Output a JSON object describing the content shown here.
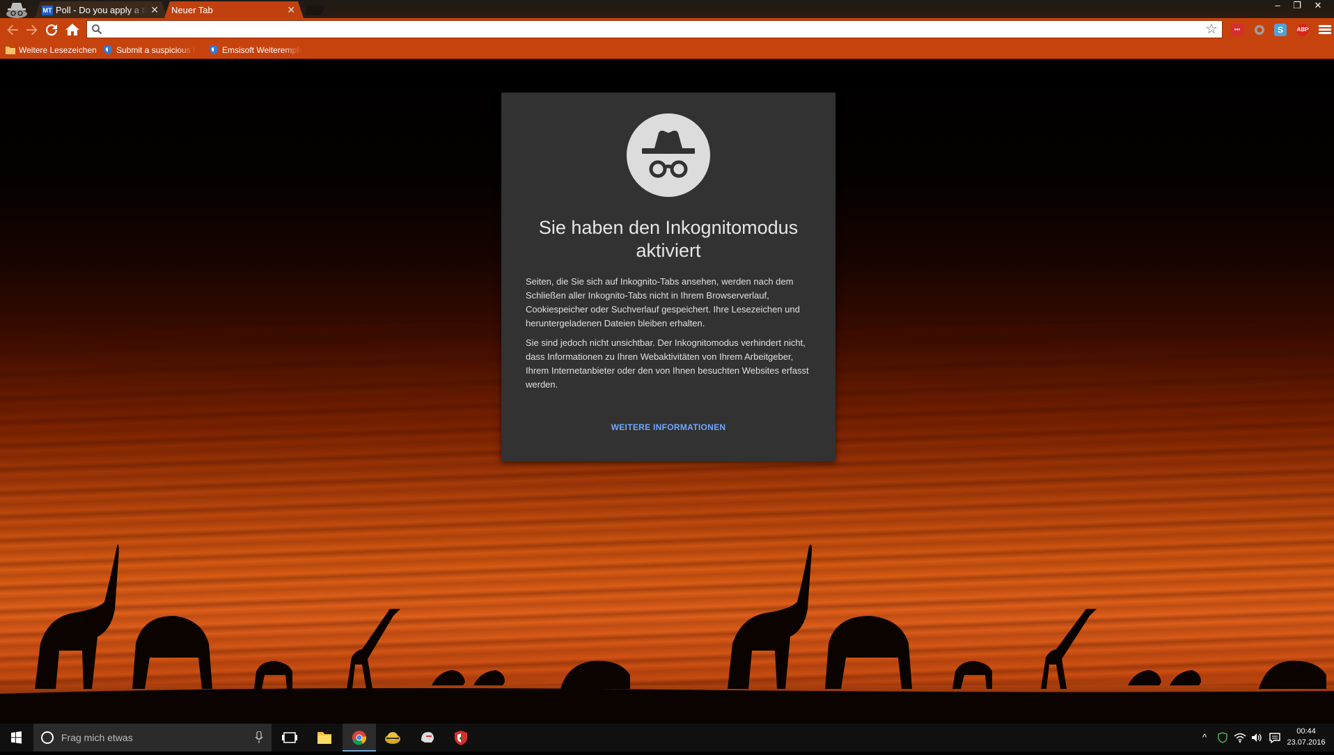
{
  "browser": {
    "tabs": [
      {
        "label": "Poll - Do you apply a them",
        "favicon_text": "MT",
        "active": false
      },
      {
        "label": "Neuer Tab",
        "active": true
      }
    ],
    "window_controls": {
      "minimize": "–",
      "restore": "❐",
      "close": "✕"
    },
    "omnibox": {
      "value": "",
      "placeholder": ""
    },
    "extensions": [
      {
        "name": "lastpass-icon",
        "text": "•••",
        "color": "#d32f2f"
      },
      {
        "name": "opera-icon",
        "text": "",
        "color": "#9e9e9e"
      },
      {
        "name": "skype-icon",
        "text": "S",
        "color": "#4fa3d9"
      },
      {
        "name": "adblock-plus-icon",
        "text": "ABP",
        "color": "#d6251d"
      }
    ],
    "bookmarks": [
      {
        "label": "Weitere Lesezeichen",
        "icon": "folder-icon"
      },
      {
        "label": "Submit a suspicious fi",
        "icon": "emsisoft-shield-icon"
      },
      {
        "label": "Emsisoft Weiterempfe",
        "icon": "emsisoft-shield-icon"
      }
    ]
  },
  "incognito": {
    "title": "Sie haben den Inkognitomodus aktiviert",
    "paragraph1": "Seiten, die Sie sich auf Inkognito-Tabs ansehen, werden nach dem Schließen aller Inkognito-Tabs nicht in Ihrem Browserverlauf, Cookiespeicher oder Suchverlauf gespeichert. Ihre Lesezeichen und heruntergeladenen Dateien bleiben erhalten.",
    "paragraph2": "Sie sind jedoch nicht unsichtbar. Der Inkognitomodus verhindert nicht, dass Informationen zu Ihren Webaktivitäten von Ihrem Arbeitgeber, Ihrem Internetanbieter oder den von Ihnen besuchten Websites erfasst werden.",
    "link": "WEITERE INFORMATIONEN"
  },
  "taskbar": {
    "search_placeholder": "Frag mich etwas",
    "time": "00:44",
    "date": "23.07.2016",
    "tray_expand": "^",
    "colors": {
      "accent": "#79a7d8"
    }
  },
  "colors": {
    "toolbar": "#c7430d",
    "card_bg": "#323232",
    "link": "#6fa8ff"
  }
}
